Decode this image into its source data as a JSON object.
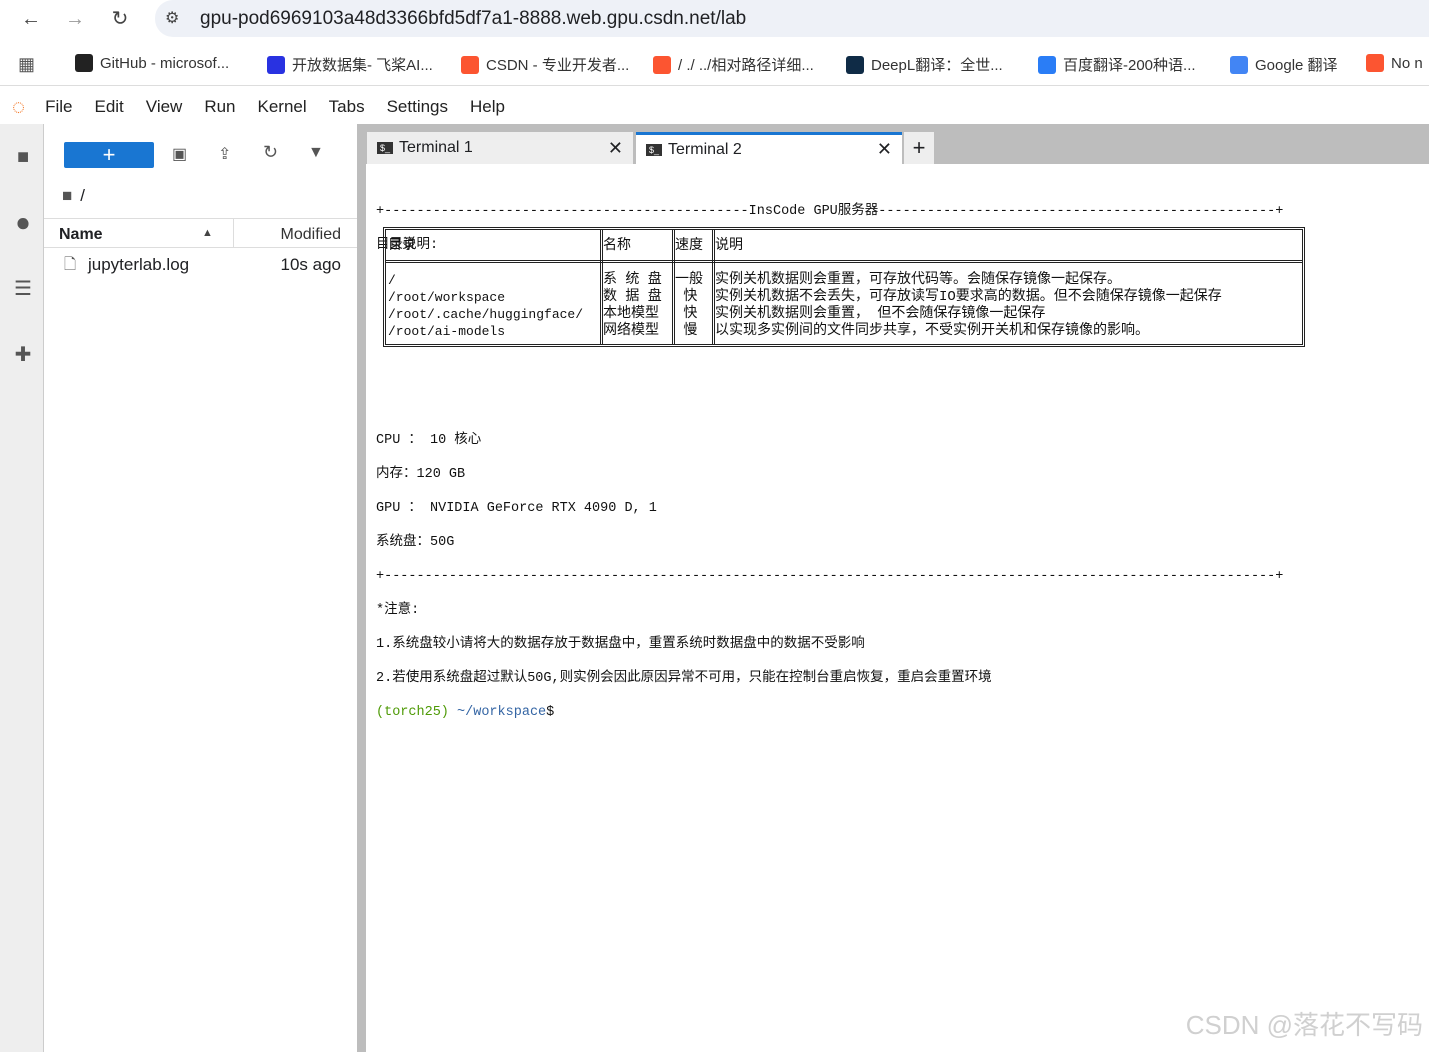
{
  "browser": {
    "url": "gpu-pod6969103a48d3366bfd5df7a1-8888.web.gpu.csdn.net/lab",
    "bookmarks": [
      {
        "label": "GitHub - microsof...",
        "color": "#222"
      },
      {
        "label": "开放数据集- 飞桨AI...",
        "color": "#2932e1"
      },
      {
        "label": "CSDN - 专业开发者...",
        "color": "#fc5531"
      },
      {
        "label": "/ ./ ../相对路径详细...",
        "color": "#fc5531"
      },
      {
        "label": "DeepL翻译：全世...",
        "color": "#0f2b46"
      },
      {
        "label": "百度翻译-200种语...",
        "color": "#2a7df6"
      },
      {
        "label": "Google 翻译",
        "color": "#4285f4"
      },
      {
        "label": "No n",
        "color": "#fc5531"
      }
    ]
  },
  "menu": [
    "File",
    "Edit",
    "View",
    "Run",
    "Kernel",
    "Tabs",
    "Settings",
    "Help"
  ],
  "filebrowser": {
    "path": "/",
    "col_name": "Name",
    "col_modified": "Modified",
    "files": [
      {
        "name": "jupyterlab.log",
        "modified": "10s ago"
      }
    ]
  },
  "tabs": [
    {
      "label": "Terminal 1"
    },
    {
      "label": "Terminal 2"
    }
  ],
  "terminal": {
    "banner": "+---------------------------------------------InsCode GPU服务器-------------------------------------------------+",
    "dir_title": "目录说明:",
    "table": {
      "headers": [
        "目录",
        "名称",
        "速度",
        "说明"
      ],
      "col0": "/\n/root/workspace\n/root/.cache/huggingface/\n/root/ai-models",
      "col1": "系 统 盘\n数 据 盘\n本地模型\n网络模型",
      "col2": "一般\n 快\n 快\n 慢",
      "col3": "实例关机数据则会重置，可存放代码等。会随保存镜像一起保存。\n实例关机数据不会丢失，可存放读写IO要求高的数据。但不会随保存镜像一起保存\n实例关机数据则会重置， 但不会随保存镜像一起保存\n以实现多实例间的文件同步共享，不受实例开关机和保存镜像的影响。"
    },
    "cpu": "CPU ： 10 核心",
    "mem": "内存：120 GB",
    "gpu": "GPU ： NVIDIA GeForce RTX 4090 D, 1",
    "disk": "系统盘：50G",
    "sep": "+--------------------------------------------------------------------------------------------------------------+",
    "note_title": "*注意:",
    "note1": "1.系统盘较小请将大的数据存放于数据盘中，重置系统时数据盘中的数据不受影响",
    "note2": "2.若使用系统盘超过默认50G,则实例会因此原因异常不可用，只能在控制台重启恢复，重启会重置环境",
    "prompt_env": "(torch25)",
    "prompt_dir": "~/workspace",
    "prompt_sym": "$"
  },
  "watermark": "CSDN @落花不写码"
}
